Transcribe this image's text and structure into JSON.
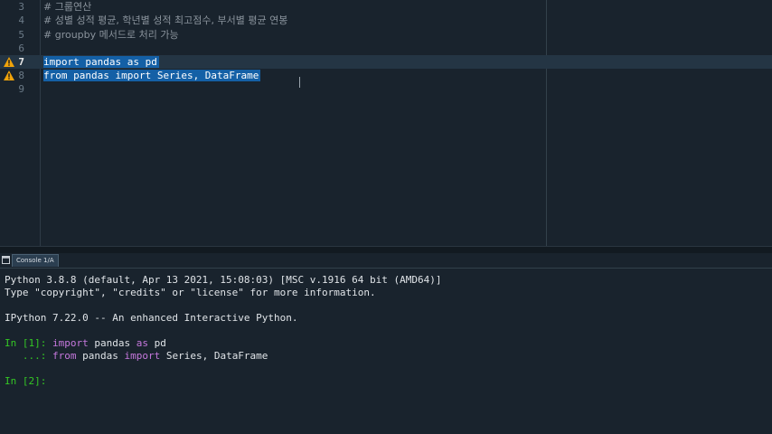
{
  "editor": {
    "lines": [
      {
        "num": "3",
        "text": "# 그룹연산",
        "kind": "comment"
      },
      {
        "num": "4",
        "text": "# 성별 성적 평균, 학년별 성적 최고점수, 부서별 평균 연봉",
        "kind": "comment"
      },
      {
        "num": "5",
        "text": "# groupby 메서드로 처리 가능",
        "kind": "comment"
      },
      {
        "num": "6",
        "text": "",
        "kind": "code"
      },
      {
        "num": "7",
        "text": "import pandas as pd",
        "kind": "selected",
        "warning": true
      },
      {
        "num": "8",
        "text": "from pandas import Series, DataFrame",
        "kind": "selected",
        "warning": true
      },
      {
        "num": "9",
        "text": "",
        "kind": "code"
      }
    ]
  },
  "console_pane": {
    "tab_label": "Console 1/A",
    "banner": [
      "Python 3.8.8 (default, Apr 13 2021, 15:08:03) [MSC v.1916 64 bit (AMD64)]",
      "Type \"copyright\", \"credits\" or \"license\" for more information.",
      "",
      "IPython 7.22.0 -- An enhanced Interactive Python."
    ],
    "in1_prompt": "In [1]:",
    "in1_kw1": "import",
    "in1_mid": " pandas ",
    "in1_kw2": "as",
    "in1_end": " pd",
    "cont_prompt": "   ...:",
    "cont_kw1": "from",
    "cont_mid": " pandas ",
    "cont_kw2": "import",
    "cont_end": " Series, DataFrame",
    "in2_prompt": "In [2]:"
  },
  "colors": {
    "background": "#19232d",
    "selection": "#1460a6",
    "prompt": "#34c724",
    "keyword": "#c678dd",
    "warning": "#f0a30a"
  }
}
